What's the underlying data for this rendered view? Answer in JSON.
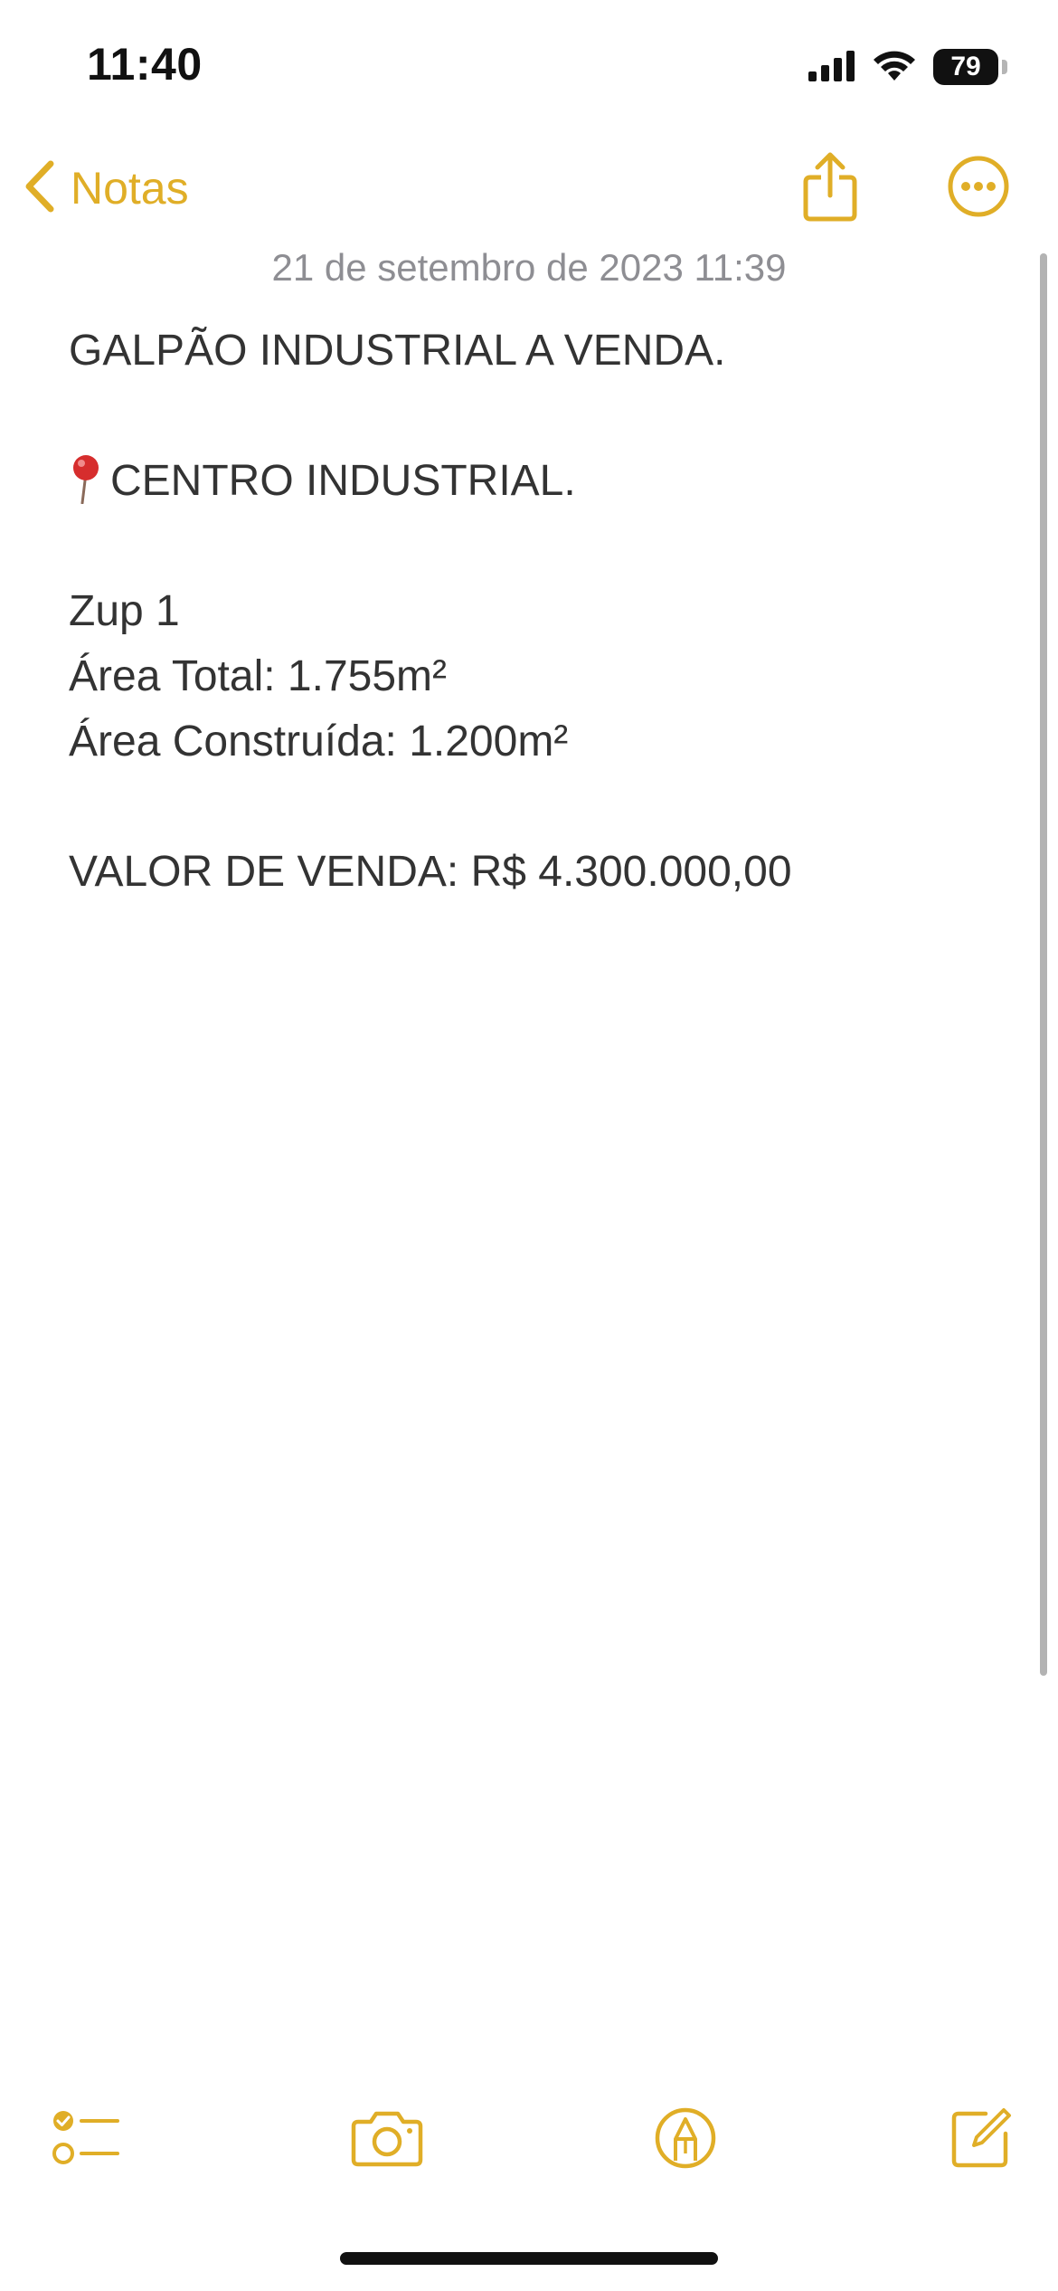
{
  "status_bar": {
    "time": "11:40",
    "battery_level": "79",
    "signal_icon": "cellular-signal-icon",
    "wifi_icon": "wifi-icon",
    "battery_icon": "battery-icon"
  },
  "nav": {
    "back_label": "Notas",
    "back_icon": "chevron-left-icon",
    "share_icon": "share-icon",
    "more_icon": "ellipsis-circle-icon"
  },
  "note": {
    "date": "21 de setembro de 2023 11:39",
    "title": "GALPÃO INDUSTRIAL A VENDA.",
    "location_icon": "round-pushpin-icon",
    "location": "CENTRO INDUSTRIAL.",
    "lines": [
      "Zup 1",
      "Área Total: 1.755m²",
      "Área Construída: 1.200m²"
    ],
    "price": "VALOR DE VENDA: R$ 4.300.000,00"
  },
  "toolbar": {
    "checklist_icon": "checklist-icon",
    "camera_icon": "camera-icon",
    "markup_icon": "markup-pen-icon",
    "compose_icon": "compose-icon"
  },
  "colors": {
    "accent": "#e0ae27",
    "text": "#333333",
    "date": "#8e8e93",
    "background": "#ffffff"
  }
}
